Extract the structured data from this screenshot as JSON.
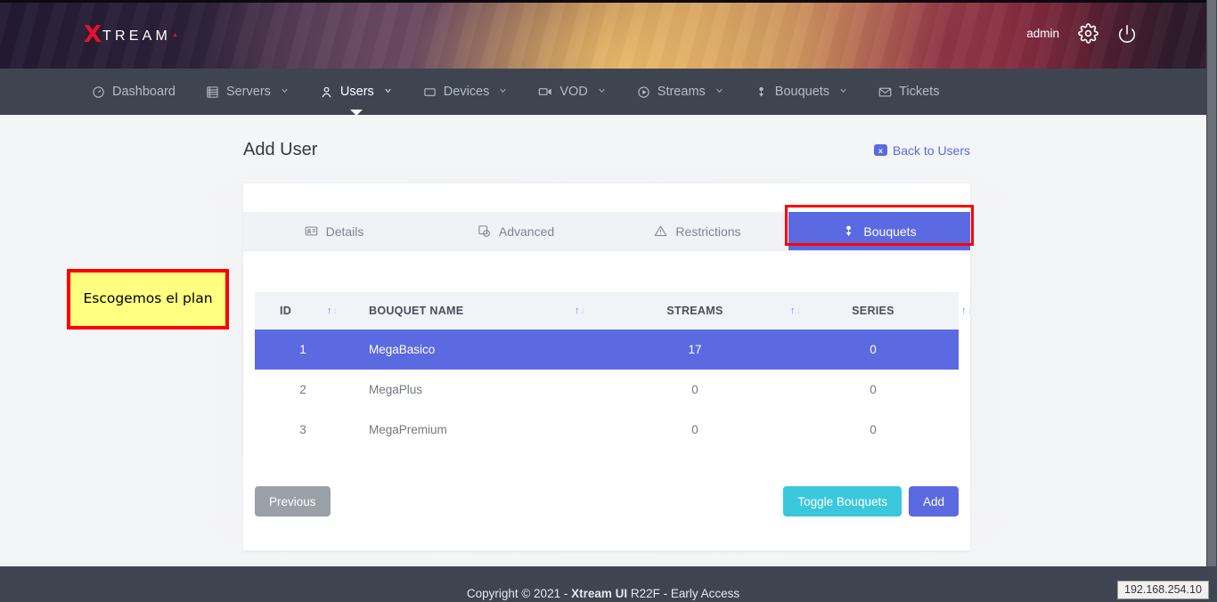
{
  "banner": {
    "logo_x": "X",
    "logo_rest": "TREAM",
    "admin_label": "admin",
    "settings_icon": "gear-icon",
    "power_icon": "power-icon"
  },
  "nav": {
    "items": [
      {
        "label": "Dashboard",
        "icon": "dashboard-icon",
        "caret": false,
        "active": false
      },
      {
        "label": "Servers",
        "icon": "server-icon",
        "caret": true,
        "active": false
      },
      {
        "label": "Users",
        "icon": "user-icon",
        "caret": true,
        "active": true
      },
      {
        "label": "Devices",
        "icon": "device-icon",
        "caret": true,
        "active": false
      },
      {
        "label": "VOD",
        "icon": "video-icon",
        "caret": true,
        "active": false
      },
      {
        "label": "Streams",
        "icon": "play-icon",
        "caret": true,
        "active": false
      },
      {
        "label": "Bouquets",
        "icon": "bouquet-icon",
        "caret": true,
        "active": false
      },
      {
        "label": "Tickets",
        "icon": "envelope-icon",
        "caret": false,
        "active": false
      }
    ]
  },
  "page": {
    "title": "Add User",
    "back_link": "Back to Users",
    "back_badge": "x"
  },
  "tabs": [
    {
      "label": "Details",
      "icon": "id-card-icon",
      "active": false
    },
    {
      "label": "Advanced",
      "icon": "clock-copy-icon",
      "active": false
    },
    {
      "label": "Restrictions",
      "icon": "warning-icon",
      "active": false
    },
    {
      "label": "Bouquets",
      "icon": "bouquet-icon",
      "active": true
    }
  ],
  "table": {
    "columns": [
      {
        "key": "id",
        "label": "ID",
        "sortable": true
      },
      {
        "key": "name",
        "label": "BOUQUET NAME",
        "sortable": true
      },
      {
        "key": "streams",
        "label": "STREAMS",
        "sortable": true
      },
      {
        "key": "series",
        "label": "SERIES",
        "sortable": true
      }
    ],
    "rows": [
      {
        "id": "1",
        "name": "MegaBasico",
        "streams": "17",
        "series": "0",
        "selected": true
      },
      {
        "id": "2",
        "name": "MegaPlus",
        "streams": "0",
        "series": "0",
        "selected": false
      },
      {
        "id": "3",
        "name": "MegaPremium",
        "streams": "0",
        "series": "0",
        "selected": false
      }
    ]
  },
  "buttons": {
    "previous": "Previous",
    "toggle_bouquets": "Toggle Bouquets",
    "add": "Add"
  },
  "annotation": {
    "text": "Escogemos el plan"
  },
  "footer": {
    "copyright_prefix": "Copyright © 2021 - ",
    "brand": "Xtream UI",
    "copyright_suffix": " R22F - Early Access"
  },
  "ip_tooltip": "192.168.254.10",
  "colors": {
    "accent": "#5b6ae0",
    "teal": "#3ac7db",
    "gray_button": "#9aa0a8",
    "navbar": "#3e4551",
    "page_bg": "#f4f5f7",
    "highlight": "#ff0000",
    "annotation_bg": "#ffff80",
    "logo_red": "#e8112d"
  }
}
